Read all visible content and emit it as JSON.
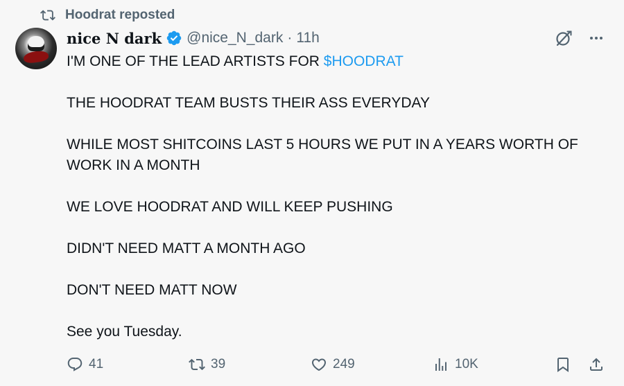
{
  "repost": {
    "label": "Hoodrat reposted",
    "icon": "repost-icon"
  },
  "author": {
    "display_name": "nice N dark",
    "verified": true,
    "handle": "@nice_N_dark",
    "separator": "·",
    "time": "11h",
    "avatar": "avatar"
  },
  "tweet": {
    "line1_prefix": "I'M ONE OF THE LEAD ARTISTS FOR ",
    "cashtag": "$HOODRAT",
    "line2": "THE HOODRAT TEAM BUSTS THEIR ASS EVERYDAY",
    "line3": "WHILE MOST SHITCOINS LAST 5 HOURS WE PUT IN A YEARS WORTH OF WORK IN A MONTH",
    "line4": "WE LOVE HOODRAT AND WILL KEEP PUSHING",
    "line5": "DIDN'T NEED MATT A MONTH AGO",
    "line6": "DON'T NEED MATT NOW",
    "line7": "See you Tuesday."
  },
  "actions": {
    "replies": "41",
    "reposts": "39",
    "likes": "249",
    "views": "10K"
  },
  "colors": {
    "accent": "#1d9bf0",
    "muted": "#536471",
    "text": "#0f1419",
    "background": "#f7f7f7"
  }
}
